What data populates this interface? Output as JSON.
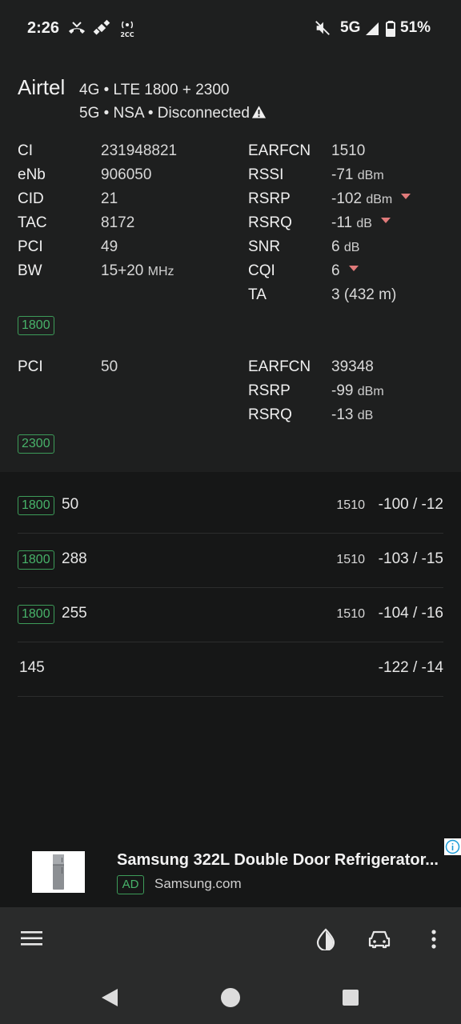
{
  "status_bar": {
    "time": "2:26",
    "network": "5G",
    "battery": "51%",
    "icons": [
      "missed-call-icon",
      "satellite-icon",
      "hotspot-2cc-icon",
      "mute-icon",
      "signal-icon",
      "battery-icon"
    ]
  },
  "header": {
    "carrier": "Airtel",
    "tech": "4G • LTE 1800 + 2300",
    "nsa_status": "5G • NSA • Disconnected"
  },
  "primary": {
    "left": [
      {
        "label": "CI",
        "value": "231948821",
        "unit": ""
      },
      {
        "label": "eNb",
        "value": "906050",
        "unit": ""
      },
      {
        "label": "CID",
        "value": "21",
        "unit": ""
      },
      {
        "label": "TAC",
        "value": "8172",
        "unit": ""
      },
      {
        "label": "PCI",
        "value": "49",
        "unit": ""
      },
      {
        "label": "BW",
        "value": "15+20",
        "unit": "MHz"
      }
    ],
    "right": [
      {
        "label": "EARFCN",
        "value": "1510",
        "unit": ""
      },
      {
        "label": "RSSI",
        "value": "-71",
        "unit": "dBm"
      },
      {
        "label": "RSRP",
        "value": "-102",
        "unit": "dBm"
      },
      {
        "label": "RSRQ",
        "value": "-11",
        "unit": "dB"
      },
      {
        "label": "SNR",
        "value": "6",
        "unit": "dB"
      },
      {
        "label": "CQI",
        "value": "6",
        "unit": ""
      },
      {
        "label": "TA",
        "value": "3 (432 m)",
        "unit": ""
      }
    ],
    "band": "1800"
  },
  "secondary": {
    "left": [
      {
        "label": "PCI",
        "value": "50"
      }
    ],
    "right": [
      {
        "label": "EARFCN",
        "value": "39348",
        "unit": ""
      },
      {
        "label": "RSRP",
        "value": "-99",
        "unit": "dBm"
      },
      {
        "label": "RSRQ",
        "value": "-13",
        "unit": "dB"
      }
    ],
    "band": "2300"
  },
  "neighbors": [
    {
      "band": "1800",
      "pci": "50",
      "earfcn": "1510",
      "signal": "-100 / -12"
    },
    {
      "band": "1800",
      "pci": "288",
      "earfcn": "1510",
      "signal": "-103 / -15"
    },
    {
      "band": "1800",
      "pci": "255",
      "earfcn": "1510",
      "signal": "-104 / -16"
    },
    {
      "band": "",
      "pci": "145",
      "earfcn": "",
      "signal": "-122 / -14"
    }
  ],
  "ad": {
    "title": "Samsung 322L Double Door Refrigerator...",
    "badge": "AD",
    "domain": "Samsung.com"
  },
  "colors": {
    "background": "#161717",
    "panel": "#1e1f1f",
    "band_green": "#48b36a",
    "trend_down": "#e07a7a"
  }
}
